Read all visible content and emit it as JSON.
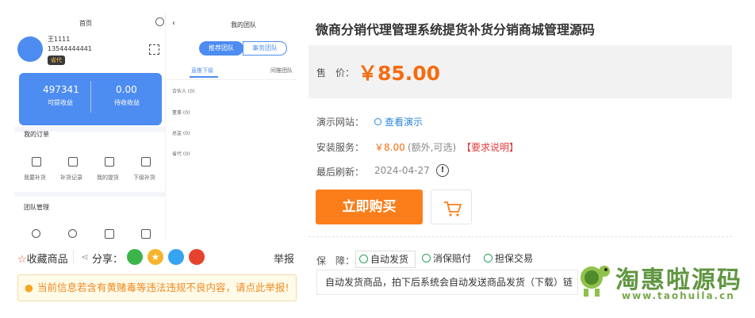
{
  "mock_left": {
    "header_title": "首页",
    "user_name": "王1111",
    "user_phone": "13544444441",
    "user_badge": "省代",
    "stats": [
      {
        "value": "497341",
        "label": "可提收益"
      },
      {
        "value": "0.00",
        "label": "待收收益"
      }
    ],
    "orders_title": "我的订单",
    "order_items": [
      "我要补货",
      "补货记录",
      "我的提货",
      "下级补货"
    ],
    "team_title": "团队管理"
  },
  "mock_right": {
    "header_title": "我的团队",
    "segments": [
      "推荐团队",
      "事务团队"
    ],
    "tabs": [
      "直推下级",
      "间推团队"
    ],
    "rows": [
      "合伙人 (0)",
      "董事 (0)",
      "总监 (0)",
      "省代 (0)"
    ]
  },
  "product": {
    "title": "微商分销代理管理系统提货补货分销商城管理源码",
    "price_label": "售　价：",
    "price": "￥85.00",
    "demo_label": "演示网站：",
    "demo_link": "查看演示",
    "install_label": "安装服务：",
    "install_price": "￥8.00",
    "install_note": "(额外,可选)",
    "install_req": "【要求说明】",
    "refresh_label": "最后刷新：",
    "refresh_date": "2024-04-27",
    "buy_button": "立即购买",
    "guarantee_label": "保　障：",
    "guarantees": [
      "自动发货",
      "消保赔付",
      "担保交易"
    ],
    "guarantee_desc": "自动发货商品，拍下后系统会自动发送商品发货（下载）链"
  },
  "actions": {
    "favorite": "收藏商品",
    "share": "分享：",
    "report": "举报",
    "notice": "当前信息若含有黄赌毒等违法违规不良内容，请点此举报!"
  },
  "watermark": {
    "title": "淘惠啦源码",
    "url": "www.taohuila.cn"
  },
  "colors": {
    "accent": "#fb7e1a",
    "price": "#f56c0f",
    "link": "#2d86d6",
    "blue": "#4d8cf0",
    "green": "#2aa35a"
  }
}
